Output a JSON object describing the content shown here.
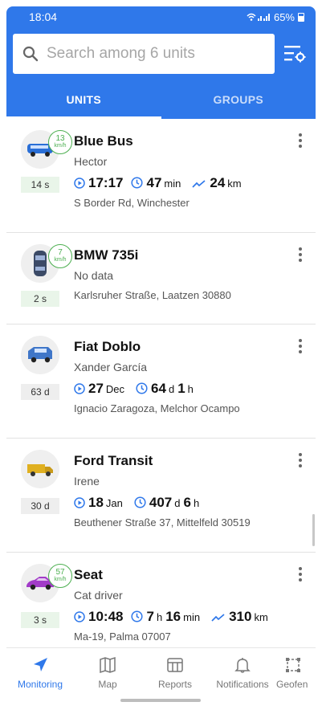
{
  "status": {
    "time": "18:04",
    "battery": "65%"
  },
  "search": {
    "placeholder": "Search among 6 units"
  },
  "tabs": [
    {
      "label": "UNITS",
      "active": true
    },
    {
      "label": "GROUPS",
      "active": false
    }
  ],
  "units": [
    {
      "name": "Blue Bus",
      "driver": "Hector",
      "speed": "13",
      "speed_unit": "km/h",
      "age": "14 s",
      "stat1_value": "17:17",
      "stat1_unit": "",
      "stat2_value": "47",
      "stat2_unit": "min",
      "stat2_value2": "",
      "stat2_unit2": "",
      "stat3_value": "24",
      "stat3_unit": "km",
      "address": "S Border Rd, Winchester",
      "car_color": "#2a6fd6"
    },
    {
      "name": "BMW 735i",
      "driver": "No data",
      "speed": "7",
      "speed_unit": "km/h",
      "age": "2 s",
      "address": "Karlsruher Straße, Laatzen 30880",
      "car_color": "#3b4a66"
    },
    {
      "name": "Fiat Doblo",
      "driver": "Xander García",
      "age": "63 d",
      "stat1_value": "27",
      "stat1_unit": "Dec",
      "stat2_value": "64",
      "stat2_unit": "d",
      "stat2_value2": "1",
      "stat2_unit2": "h",
      "address": "Ignacio Zaragoza, Melchor Ocampo",
      "car_color": "#3f76c8"
    },
    {
      "name": "Ford Transit",
      "driver": "Irene",
      "age": "30 d",
      "stat1_value": "18",
      "stat1_unit": "Jan",
      "stat2_value": "407",
      "stat2_unit": "d",
      "stat2_value2": "6",
      "stat2_unit2": "h",
      "address": "Beuthener Straße 37, Mittelfeld 30519",
      "car_color": "#e0b020"
    },
    {
      "name": "Seat",
      "driver": "Cat driver",
      "speed": "57",
      "speed_unit": "km/h",
      "age": "3 s",
      "stat1_value": "10:48",
      "stat1_unit": "",
      "stat2_value": "7",
      "stat2_unit": "h",
      "stat2_value2": "16",
      "stat2_unit2": "min",
      "stat3_value": "310",
      "stat3_unit": "km",
      "address": "Ma-19, Palma 07007",
      "car_color": "#a23cc8"
    }
  ],
  "nav": [
    {
      "label": "Monitoring",
      "icon": "navigation-arrow-icon",
      "active": true
    },
    {
      "label": "Map",
      "icon": "map-icon",
      "active": false
    },
    {
      "label": "Reports",
      "icon": "reports-icon",
      "active": false
    },
    {
      "label": "Notifications",
      "icon": "bell-icon",
      "active": false
    },
    {
      "label": "Geofen",
      "icon": "geofence-icon",
      "active": false
    }
  ],
  "colors": {
    "accent": "#2f78ea",
    "moving": "#4caf50"
  }
}
